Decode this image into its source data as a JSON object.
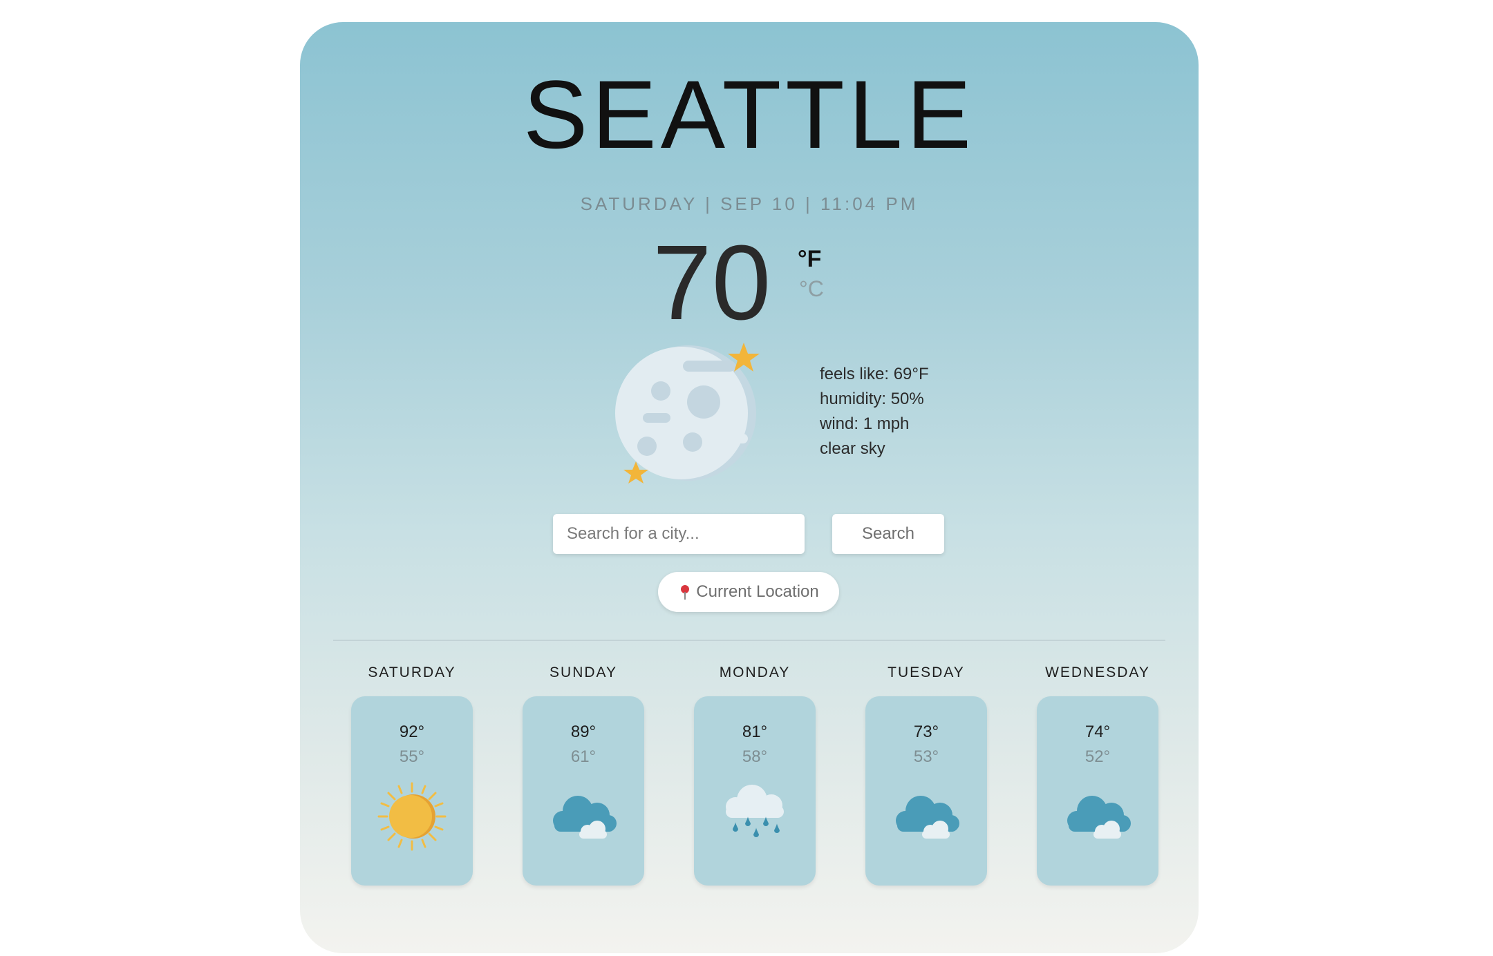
{
  "current": {
    "city": "SEATTLE",
    "datetime": "SATURDAY | SEP 10 | 11:04 PM",
    "temperature": "70",
    "unit_f": "°F",
    "unit_c": "°C",
    "condition_icon": "moon-stars-icon",
    "feels_like": "feels like: 69°F",
    "humidity": "humidity: 50%",
    "wind": "wind: 1 mph",
    "description": "clear sky"
  },
  "search": {
    "placeholder": "Search for a city...",
    "button_label": "Search",
    "location_label": "Current Location",
    "location_icon": "pin-icon"
  },
  "forecast": [
    {
      "day": "SATURDAY",
      "high": "92°",
      "low": "55°",
      "icon": "sun-icon"
    },
    {
      "day": "SUNDAY",
      "high": "89°",
      "low": "61°",
      "icon": "clouds-icon"
    },
    {
      "day": "MONDAY",
      "high": "81°",
      "low": "58°",
      "icon": "rain-cloud-icon"
    },
    {
      "day": "TUESDAY",
      "high": "73°",
      "low": "53°",
      "icon": "clouds-icon"
    },
    {
      "day": "WEDNESDAY",
      "high": "74°",
      "low": "52°",
      "icon": "clouds-icon"
    }
  ],
  "colors": {
    "card_top": "#8cc3d2",
    "card_bottom": "#f3f3ef",
    "forecast_card": "#b1d4dc",
    "sun": "#f2bd44",
    "cloud": "#4a9cb8",
    "star": "#f2b53a"
  }
}
